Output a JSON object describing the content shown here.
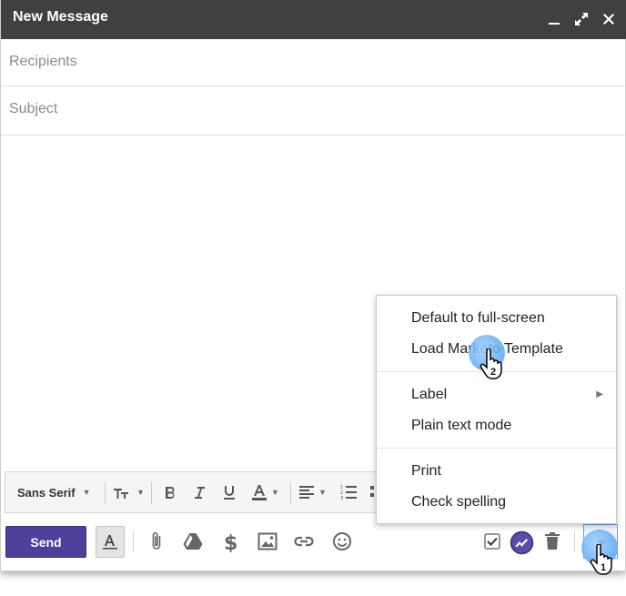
{
  "window": {
    "title": "New Message",
    "controls": [
      "minimize-icon",
      "expand-icon",
      "close-icon"
    ]
  },
  "fields": {
    "recipients_placeholder": "Recipients",
    "recipients_value": "",
    "subject_placeholder": "Subject",
    "subject_value": ""
  },
  "formatting": {
    "font_name": "Sans Serif",
    "icons": [
      "font-size-icon",
      "bold-icon",
      "italic-icon",
      "underline-icon",
      "text-color-icon",
      "align-icon",
      "numbered-list-icon",
      "bulleted-list-icon"
    ]
  },
  "bottom_bar": {
    "send_label": "Send",
    "icons": [
      "formatting-toggle-icon",
      "attach-icon",
      "drive-icon",
      "money-icon",
      "photo-icon",
      "link-icon",
      "emoji-icon",
      "checkbox-icon",
      "marketo-icon",
      "trash-icon",
      "more-options-icon"
    ]
  },
  "menu": {
    "items": [
      {
        "label": "Default to full-screen"
      },
      {
        "label": "Load Marketo Template"
      },
      {
        "label": "Label",
        "has_submenu": true
      },
      {
        "label": "Plain text mode"
      },
      {
        "label": "Print"
      },
      {
        "label": "Check spelling"
      }
    ]
  },
  "markers": {
    "first": "1",
    "second": "2"
  },
  "colors": {
    "titlebar": "#404040",
    "send_button": "#4d3f9a",
    "marker": "#57a6f3"
  }
}
